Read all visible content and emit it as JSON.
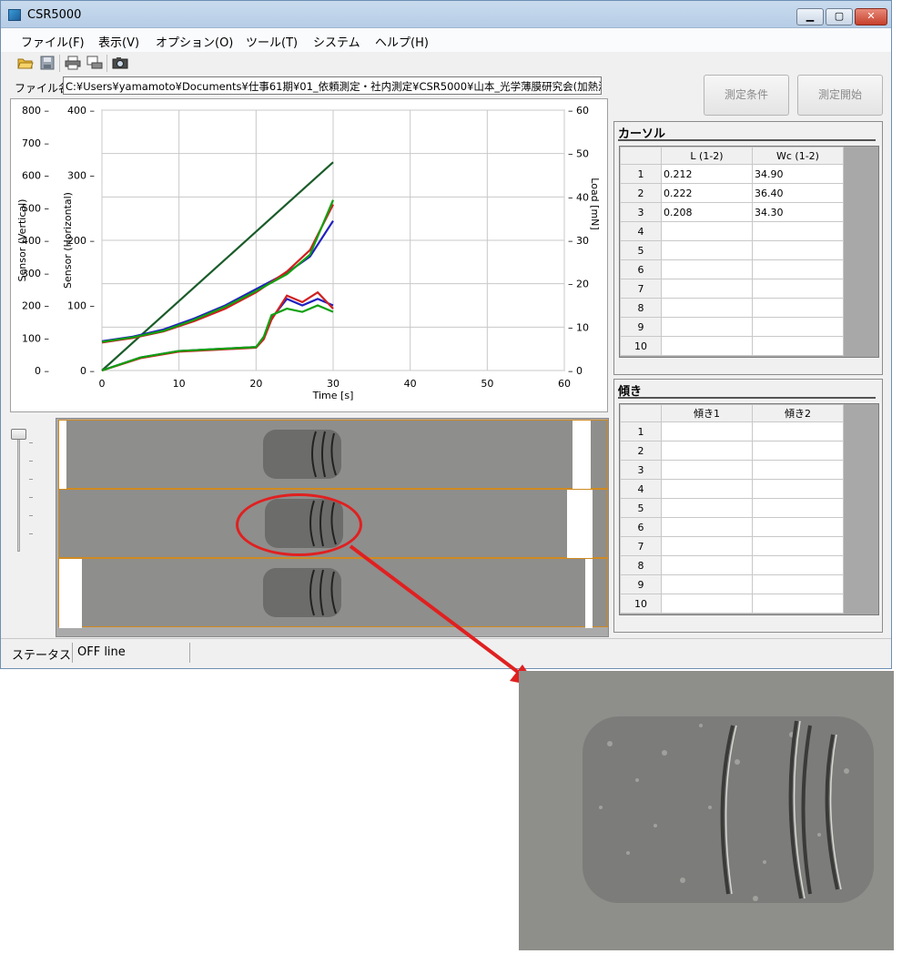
{
  "window": {
    "title": "CSR5000",
    "minimize_label": "▁",
    "maximize_label": "▢",
    "close_label": "✕"
  },
  "menu": [
    {
      "label": "ファイル(F)"
    },
    {
      "label": "表示(V)"
    },
    {
      "label": "オプション(O)"
    },
    {
      "label": "ツール(T)"
    },
    {
      "label": "システム"
    },
    {
      "label": "ヘルプ(H)"
    }
  ],
  "toolbar": {
    "icons": [
      "open-folder-icon",
      "save-icon",
      "print-icon",
      "print-preview-icon",
      "camera-icon"
    ]
  },
  "file": {
    "label": "ファイル名",
    "path": "C:¥Users¥yamamoto¥Documents¥仕事61期¥01_依頼測定・社内測定¥CSR5000¥山本_光学薄膜研究会(加熱測定)"
  },
  "buttons": {
    "condition": "測定条件",
    "start": "測定開始"
  },
  "chart_data": {
    "type": "line",
    "xlabel": "Time [s]",
    "x_ticks": [
      0,
      10,
      20,
      30,
      40,
      50,
      60
    ],
    "xlim": [
      0,
      60
    ],
    "y_left_outer": {
      "label": "Sensor (Vertical)",
      "ticks": [
        0,
        100,
        200,
        300,
        400,
        500,
        600,
        700,
        800
      ],
      "lim": [
        0,
        800
      ]
    },
    "y_left_inner": {
      "label": "Sensor (Horizontal)",
      "ticks": [
        0,
        100,
        200,
        300,
        400
      ],
      "lim": [
        0,
        400
      ]
    },
    "y_right": {
      "label": "Load [mN]",
      "ticks": [
        0,
        10,
        20,
        30,
        40,
        50,
        60
      ],
      "lim": [
        0,
        60
      ]
    },
    "grid": true,
    "series": [
      {
        "color": "#1a5c2a",
        "axis": "right",
        "x": [
          0,
          5,
          10,
          15,
          20,
          25,
          30
        ],
        "y": [
          0,
          8,
          16,
          24,
          32,
          40,
          48
        ]
      },
      {
        "color": "#2020c0",
        "axis": "inner",
        "x": [
          0,
          4,
          8,
          12,
          16,
          20,
          24,
          27,
          30
        ],
        "y": [
          45,
          52,
          63,
          80,
          100,
          125,
          150,
          175,
          230
        ]
      },
      {
        "color": "#d02020",
        "axis": "inner",
        "x": [
          0,
          4,
          8,
          12,
          16,
          20,
          24,
          27,
          30
        ],
        "y": [
          43,
          50,
          60,
          76,
          95,
          120,
          152,
          185,
          255
        ]
      },
      {
        "color": "#10a010",
        "axis": "inner",
        "x": [
          0,
          4,
          8,
          12,
          16,
          20,
          24,
          27,
          30
        ],
        "y": [
          44,
          51,
          61,
          78,
          98,
          122,
          148,
          178,
          262
        ]
      },
      {
        "color": "#2020c0",
        "axis": "inner",
        "x": [
          0,
          5,
          10,
          15,
          20,
          21,
          22,
          24,
          26,
          28,
          30
        ],
        "y": [
          0,
          20,
          30,
          33,
          36,
          50,
          80,
          110,
          100,
          110,
          100
        ]
      },
      {
        "color": "#d02020",
        "axis": "inner",
        "x": [
          0,
          5,
          10,
          15,
          20,
          21,
          22,
          24,
          26,
          28,
          30
        ],
        "y": [
          0,
          19,
          29,
          32,
          35,
          48,
          78,
          115,
          105,
          120,
          95
        ]
      },
      {
        "color": "#10a010",
        "axis": "inner",
        "x": [
          0,
          5,
          10,
          15,
          20,
          21,
          22,
          24,
          26,
          28,
          30
        ],
        "y": [
          0,
          20,
          30,
          33,
          36,
          52,
          85,
          95,
          90,
          100,
          90
        ]
      }
    ]
  },
  "cursor": {
    "title": "カーソル",
    "headers": [
      "L (1-2)",
      "Wc (1-2)"
    ],
    "rows": [
      {
        "n": "1",
        "a": "0.212",
        "b": "34.90"
      },
      {
        "n": "2",
        "a": "0.222",
        "b": "36.40"
      },
      {
        "n": "3",
        "a": "0.208",
        "b": "34.30"
      },
      {
        "n": "4",
        "a": "",
        "b": ""
      },
      {
        "n": "5",
        "a": "",
        "b": ""
      },
      {
        "n": "6",
        "a": "",
        "b": ""
      },
      {
        "n": "7",
        "a": "",
        "b": ""
      },
      {
        "n": "8",
        "a": "",
        "b": ""
      },
      {
        "n": "9",
        "a": "",
        "b": ""
      },
      {
        "n": "10",
        "a": "",
        "b": ""
      }
    ]
  },
  "slope": {
    "title": "傾き",
    "headers": [
      "傾き1",
      "傾き2"
    ],
    "rows": [
      {
        "n": "1",
        "a": "",
        "b": ""
      },
      {
        "n": "2",
        "a": "",
        "b": ""
      },
      {
        "n": "3",
        "a": "",
        "b": ""
      },
      {
        "n": "4",
        "a": "",
        "b": ""
      },
      {
        "n": "5",
        "a": "",
        "b": ""
      },
      {
        "n": "6",
        "a": "",
        "b": ""
      },
      {
        "n": "7",
        "a": "",
        "b": ""
      },
      {
        "n": "8",
        "a": "",
        "b": ""
      },
      {
        "n": "9",
        "a": "",
        "b": ""
      },
      {
        "n": "10",
        "a": "",
        "b": ""
      }
    ]
  },
  "status": {
    "label": "ステータス",
    "value": "OFF line"
  },
  "annotation": {
    "highlight_color": "#e02020"
  }
}
